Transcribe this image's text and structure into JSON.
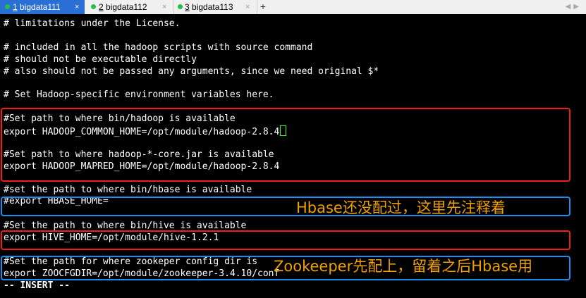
{
  "tabs": [
    {
      "num": "1",
      "name": "bigdata111",
      "status_color": "#21c04a"
    },
    {
      "num": "2",
      "name": "bigdata112",
      "status_color": "#21c04a"
    },
    {
      "num": "3",
      "name": "bigdata113",
      "status_color": "#21c04a"
    }
  ],
  "tab_close_glyph": "×",
  "new_tab_glyph": "+",
  "terminal": {
    "lines": [
      "# limitations under the License.",
      "",
      "# included in all the hadoop scripts with source command",
      "# should not be executable directly",
      "# also should not be passed any arguments, since we need original $*",
      "",
      "# Set Hadoop-specific environment variables here.",
      "",
      "#Set path to where bin/hadoop is available",
      "export HADOOP_COMMON_HOME=/opt/module/hadoop-2.8.4",
      "",
      "#Set path to where hadoop-*-core.jar is available",
      "export HADOOP_MAPRED_HOME=/opt/module/hadoop-2.8.4",
      "",
      "#set the path to where bin/hbase is available",
      "#export HBASE_HOME=",
      "",
      "#Set the path to where bin/hive is available",
      "export HIVE_HOME=/opt/module/hive-1.2.1",
      "",
      "#Set the path for where zookeper config dir is",
      "export ZOOCFGDIR=/opt/module/zookeeper-3.4.10/conf",
      "-- INSERT --"
    ]
  },
  "annotations": {
    "hbase_note": "Hbase还没配过，这里先注释着",
    "zookeeper_note": "Zookeeper先配上，留着之后Hbase用"
  },
  "colors": {
    "highlight_red": "#f21d1d",
    "highlight_blue": "#1c8ef0",
    "note_text": "#f0a000",
    "active_tab": "#2a6fd6"
  }
}
